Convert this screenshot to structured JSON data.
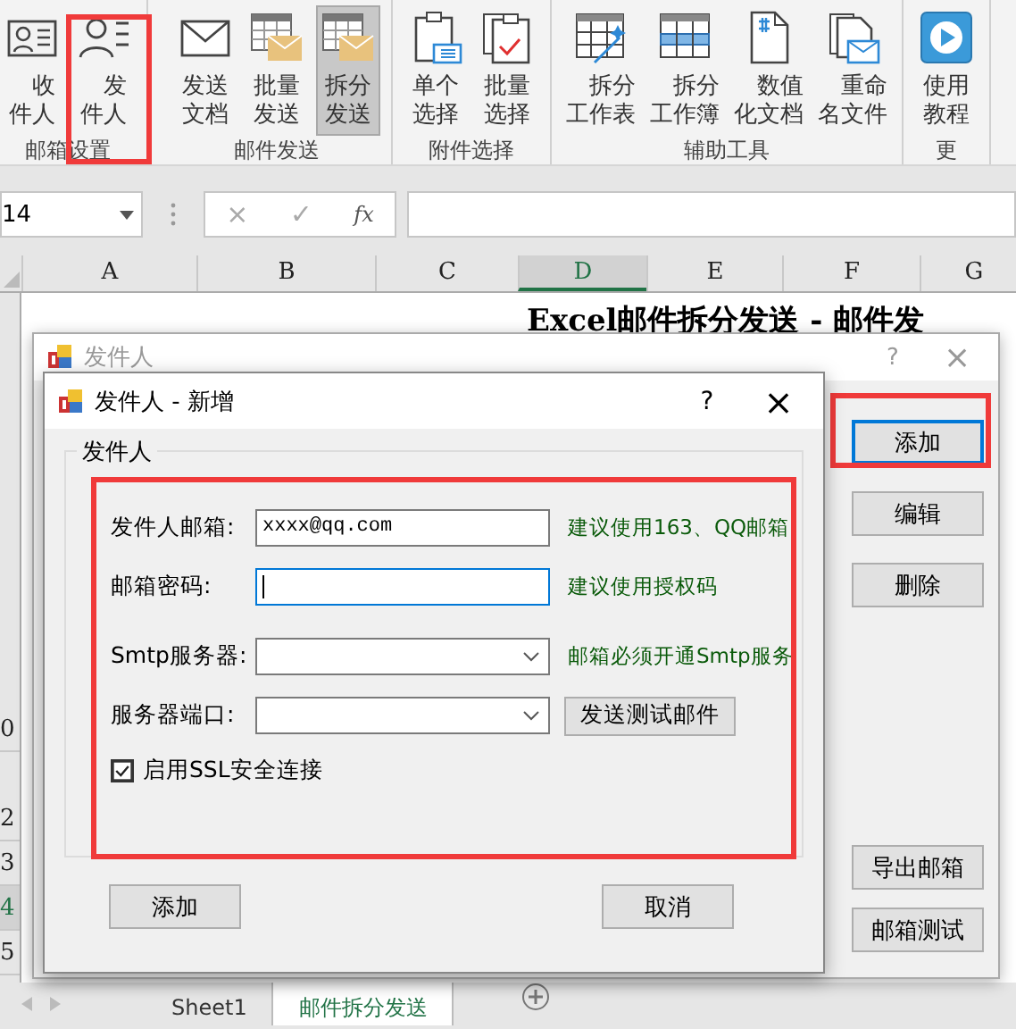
{
  "ribbon": {
    "groups": [
      {
        "label": "邮箱设置",
        "buttons": [
          {
            "label": "收件人",
            "pressed": false,
            "highlighted": false
          },
          {
            "label": "发件人",
            "pressed": false,
            "highlighted": true
          }
        ]
      },
      {
        "label": "邮件发送",
        "buttons": [
          {
            "label": "发送文档",
            "pressed": false,
            "highlighted": false
          },
          {
            "label": "批量发送",
            "pressed": false,
            "highlighted": false
          },
          {
            "label": "拆分发送",
            "pressed": true,
            "highlighted": false
          }
        ]
      },
      {
        "label": "附件选择",
        "buttons": [
          {
            "label": "单个选择",
            "pressed": false,
            "highlighted": false
          },
          {
            "label": "批量选择",
            "pressed": false,
            "highlighted": false
          }
        ]
      },
      {
        "label": "辅助工具",
        "buttons": [
          {
            "label": "拆分工作表",
            "pressed": false,
            "highlighted": false
          },
          {
            "label": "拆分工作簿",
            "pressed": false,
            "highlighted": false
          },
          {
            "label": "数值化文档",
            "pressed": false,
            "highlighted": false
          },
          {
            "label": "重命名文件",
            "pressed": false,
            "highlighted": false
          }
        ]
      },
      {
        "label": "更",
        "buttons": [
          {
            "label": "使用教程",
            "pressed": false,
            "highlighted": false
          }
        ]
      }
    ]
  },
  "formula_bar": {
    "name_box": "14",
    "cancel": "×",
    "enter": "✓",
    "function": "fx"
  },
  "sheet": {
    "columns": [
      {
        "label": "A",
        "selected": false
      },
      {
        "label": "B",
        "selected": false
      },
      {
        "label": "C",
        "selected": false
      },
      {
        "label": "D",
        "selected": true
      },
      {
        "label": "E",
        "selected": false
      },
      {
        "label": "F",
        "selected": false
      },
      {
        "label": "G",
        "selected": false
      }
    ],
    "title_cell": "Excel邮件拆分发送 - 邮件发",
    "row_headers": [
      {
        "label": "0",
        "selected": false
      },
      {
        "label": "2",
        "selected": false
      },
      {
        "label": "3",
        "selected": false
      },
      {
        "label": "4",
        "selected": true
      },
      {
        "label": "5",
        "selected": false
      }
    ],
    "tabs": [
      {
        "label": "Sheet1",
        "selected": false
      },
      {
        "label": "邮件拆分发送",
        "selected": true
      }
    ]
  },
  "sender_window": {
    "title": "发件人",
    "help": "?",
    "close": "×",
    "side_buttons": [
      {
        "label": "添加",
        "focused": true,
        "highlighted": true
      },
      {
        "label": "编辑",
        "focused": false,
        "highlighted": false
      },
      {
        "label": "删除",
        "focused": false,
        "highlighted": false
      }
    ],
    "bottom_buttons": [
      {
        "label": "导出邮箱"
      },
      {
        "label": "邮箱测试"
      }
    ]
  },
  "dialog": {
    "title": "发件人 - 新增",
    "help": "?",
    "close": "×",
    "group": {
      "label": "发件人",
      "highlighted": true,
      "fields": [
        {
          "label": "发件人邮箱:",
          "kind": "text",
          "value": "xxxx@qq.com",
          "focused": false,
          "note": "建议使用163、QQ邮箱"
        },
        {
          "label": "邮箱密码:",
          "kind": "text",
          "focused": true,
          "note": "建议使用授权码"
        },
        {
          "label": "Smtp服务器:",
          "kind": "combo",
          "focused": false,
          "note": "邮箱必须开通Smtp服务"
        },
        {
          "label": "服务器端口:",
          "kind": "combo",
          "focused": false,
          "button": "发送测试邮件"
        }
      ],
      "checkbox": {
        "label": "启用SSL安全连接",
        "checked": true
      }
    },
    "buttons": [
      {
        "label": "添加"
      },
      {
        "label": "取消"
      }
    ]
  }
}
